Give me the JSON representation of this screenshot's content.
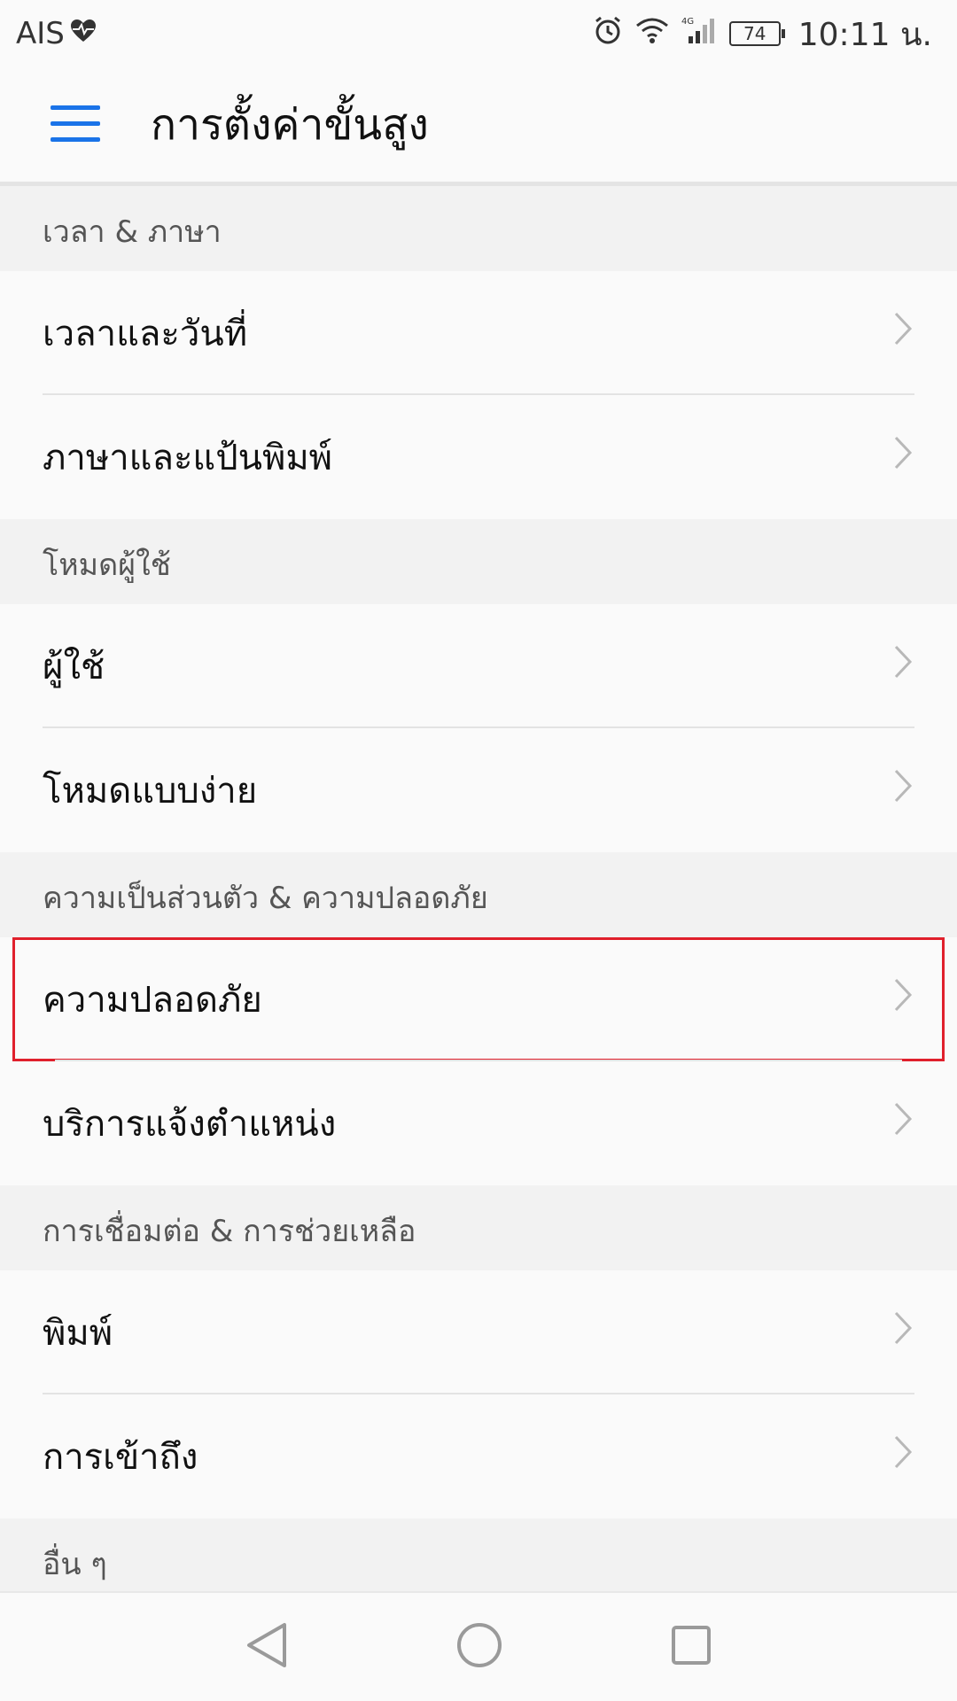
{
  "status_bar": {
    "carrier": "AIS",
    "time": "10:11 น.",
    "battery": "74",
    "network": "4G"
  },
  "app_bar": {
    "title": "การตั้งค่าขั้นสูง"
  },
  "sections": [
    {
      "header": "เวลา & ภาษา",
      "items": [
        "เวลาและวันที่",
        "ภาษาและแป้นพิมพ์"
      ]
    },
    {
      "header": "โหมดผู้ใช้",
      "items": [
        "ผู้ใช้",
        "โหมดแบบง่าย"
      ]
    },
    {
      "header": "ความเป็นส่วนตัว & ความปลอดภัย",
      "items": [
        "ความปลอดภัย",
        "บริการแจ้งตำแหน่ง"
      ]
    },
    {
      "header": "การเชื่อมต่อ & การช่วยเหลือ",
      "items": [
        "พิมพ์",
        "การเข้าถึง"
      ]
    },
    {
      "header": "อื่น ๆ",
      "items": []
    }
  ],
  "colors": {
    "accent": "#1a73e8",
    "highlight": "#e0202c"
  },
  "icons": {
    "menu": "hamburger-icon",
    "chevron": "chevron-right-icon",
    "back": "back-triangle-icon",
    "home": "home-circle-icon",
    "recents": "recents-square-icon"
  }
}
